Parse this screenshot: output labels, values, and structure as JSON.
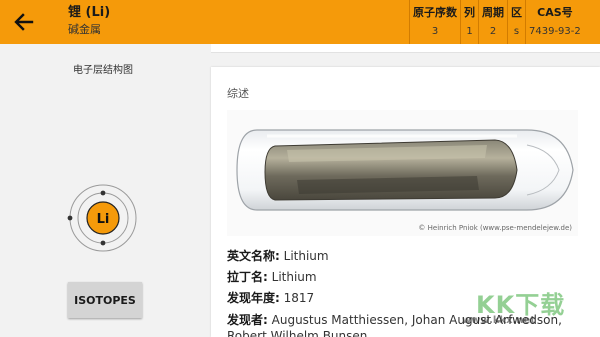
{
  "appbar": {
    "title": "锂 (Li)",
    "subtitle": "碱金属",
    "back_icon": "arrow-left-icon",
    "bg_color": "#f59a0a",
    "properties": [
      {
        "label": "原子序数",
        "value": "3"
      },
      {
        "label": "列",
        "value": "1"
      },
      {
        "label": "周期",
        "value": "2"
      },
      {
        "label": "区",
        "value": "s"
      },
      {
        "label": "CAS号",
        "value": "7439-93-2"
      }
    ]
  },
  "left_panel": {
    "diagram_label": "电子层结构图",
    "nucleus_symbol": "Li",
    "shell_electrons": [
      2,
      1
    ],
    "isotopes_button": "ISOTOPES"
  },
  "overview": {
    "section_title": "综述",
    "photo_credit": "© Heinrich Pniok (www.pse-mendelejew.de)",
    "rows": [
      {
        "key": "英文名称:",
        "value": "Lithium"
      },
      {
        "key": "拉丁名:",
        "value": "Lithium"
      },
      {
        "key": "发现年度:",
        "value": "1817"
      },
      {
        "key": "发现者:",
        "value": "Augustus Matthiessen, Johan August Arfwedson, Robert Wilhelm Bunsen"
      }
    ]
  },
  "watermark": {
    "logo_text": "KK下载",
    "url": "www.kkx.net"
  }
}
